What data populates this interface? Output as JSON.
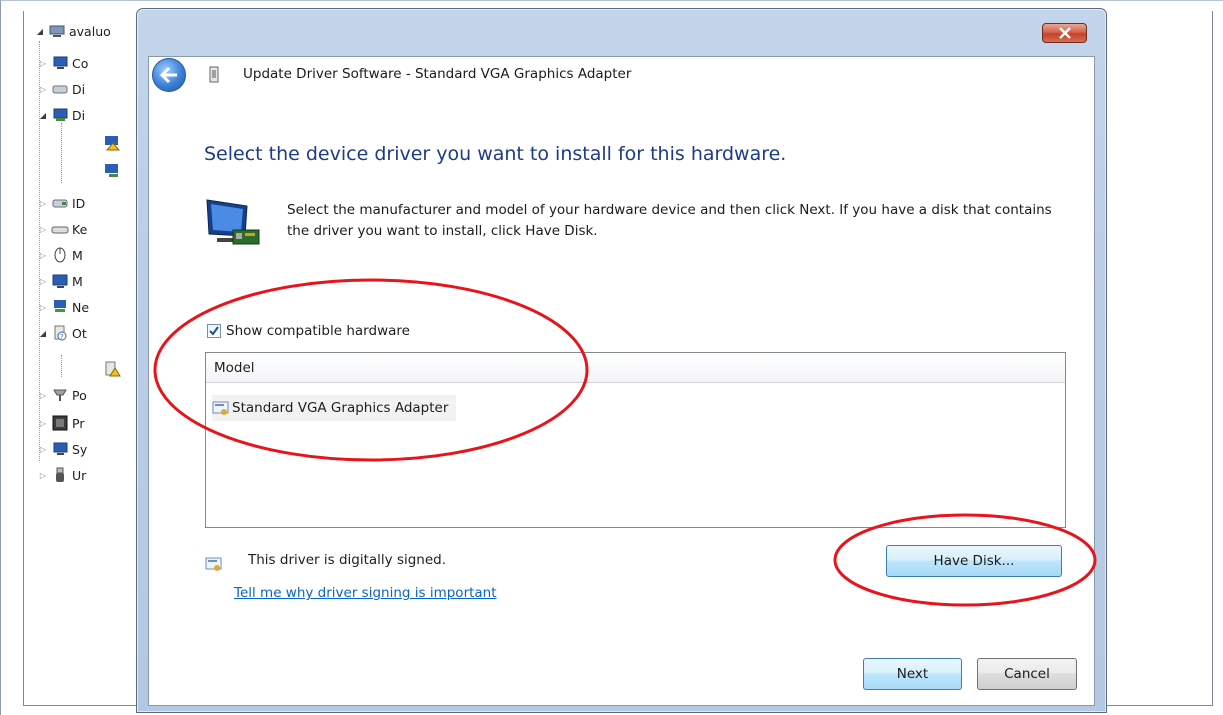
{
  "tree": {
    "root_label": "avaluo",
    "items": [
      {
        "label": "Co",
        "icon": "computer-icon"
      },
      {
        "label": "Di",
        "icon": "disk-drive-icon"
      },
      {
        "label": "Di",
        "icon": "display-adapter-icon"
      },
      {
        "label": "ID",
        "icon": "ide-controller-icon"
      },
      {
        "label": "Ke",
        "icon": "keyboard-icon"
      },
      {
        "label": "M",
        "icon": "mouse-icon"
      },
      {
        "label": "M",
        "icon": "monitor-icon"
      },
      {
        "label": "Ne",
        "icon": "network-adapter-icon"
      },
      {
        "label": "Ot",
        "icon": "other-devices-icon"
      },
      {
        "label": "Po",
        "icon": "ports-icon"
      },
      {
        "label": "Pr",
        "icon": "processor-icon"
      },
      {
        "label": "Sy",
        "icon": "system-devices-icon"
      },
      {
        "label": "Ur",
        "icon": "usb-icon"
      }
    ]
  },
  "dialog": {
    "title": "Update Driver Software - Standard VGA Graphics Adapter",
    "heading": "Select the device driver you want to install for this hardware.",
    "instructions": "Select the manufacturer and model of your hardware device and then click Next. If you have a disk that contains the driver you want to install, click Have Disk.",
    "show_compatible_label": "Show compatible hardware",
    "show_compatible_checked": true,
    "model_header": "Model",
    "models": [
      "Standard VGA Graphics Adapter"
    ],
    "signed_text": "This driver is digitally signed.",
    "signing_link": "Tell me why driver signing is important",
    "have_disk_label": "Have Disk...",
    "next_label": "Next",
    "cancel_label": "Cancel"
  },
  "colors": {
    "heading": "#1e3a8a",
    "link": "#0a66c2",
    "annotation": "#e8141c"
  }
}
